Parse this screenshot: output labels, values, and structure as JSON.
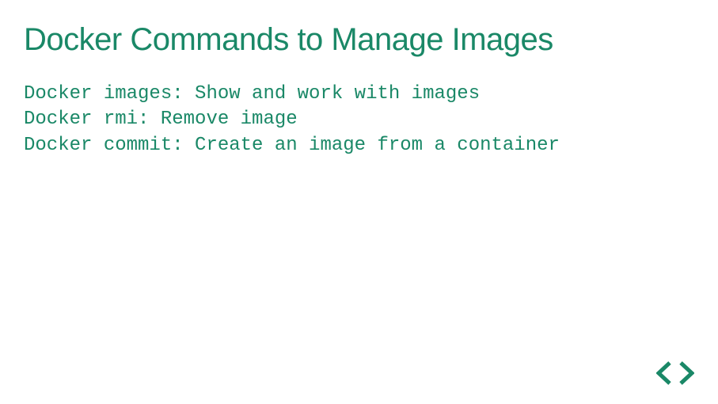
{
  "title": "Docker Commands to Manage Images",
  "commands": [
    "Docker images: Show and work with images",
    "Docker rmi: Remove image",
    "Docker commit: Create an image from a container"
  ],
  "colors": {
    "accent": "#1a8867"
  }
}
